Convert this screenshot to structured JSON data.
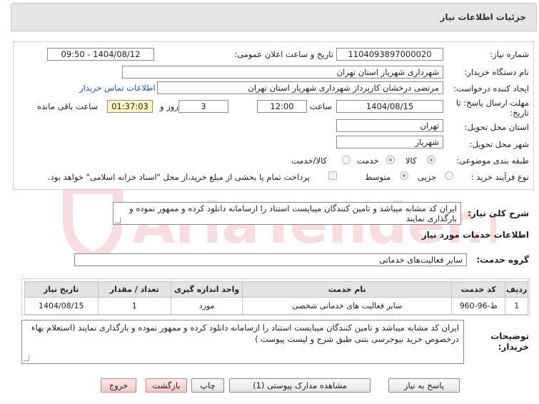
{
  "header": {
    "title": "جزئیات اطلاعات نیاز"
  },
  "form": {
    "need_number_label": "شماره نیاز:",
    "need_number": "1104093897000020",
    "announce_label": "تاریخ و ساعت اعلان عمومی:",
    "announce_value": "1404/08/12 - 09:50",
    "buyer_label": "نام دستگاه خریدار:",
    "buyer_value": "شهرداری شهریار استان تهران",
    "creator_label": "ایجاد کننده درخواست:",
    "creator_value": "مرتضی درخشان کارپرداز شهرداری شهریار استان تهران",
    "contact_link": "اطلاعات تماس خریدار",
    "deadline_label_1": "مهلت ارسال پاسخ: تا",
    "deadline_label_2": "تاریخ:",
    "deadline_date": "1404/08/15",
    "time_label": "ساعت",
    "deadline_time": "12:00",
    "days_value": "3",
    "days_label": "روز و",
    "remaining_time": "01:37:03",
    "remaining_label": "ساعت باقی مانده",
    "province_label": "استان محل تحویل:",
    "province_value": "تهران",
    "city_label": "شهر محل تحویل:",
    "city_value": "شهریار",
    "category_label": "طبقه بندی موضوعی:",
    "category_options": [
      "کالا",
      "خدمت",
      "کالا/خدمت"
    ],
    "process_label": "نوع فرآیند خرید :",
    "process_options": [
      "جزیی",
      "متوسط"
    ],
    "payment_note": "پرداخت تمام یا بخشی از مبلغ خرید،از محل \"اسناد خزانه اسلامی\" خواهد بود."
  },
  "summary": {
    "label": "شرح کلی نیاز:",
    "text": "ایران کد مشابه میباشد و تامین کنندگان میبایست استناد را ازسامانه دانلود کرده و ممهور نموده و بارگذاری نمایند"
  },
  "services": {
    "section_title": "اطلاعات خدمات مورد نیاز",
    "group_label": "گروه خدمت:",
    "group_value": "سایر فعالیت‌های خدماتی",
    "columns": [
      "ردیف",
      "کد خدمت",
      "نام خدمت",
      "واحد اندازه گیری",
      "تعداد / مقدار",
      "تاریخ نیاز"
    ],
    "rows": [
      [
        "1",
        "ط-96-960",
        "سایر فعالیت های خدماتی شخصی",
        "مورد",
        "1",
        "1404/08/15"
      ]
    ]
  },
  "notes": {
    "label_1": "توضیحات",
    "label_2": "خریدار:",
    "text": "ایران کد مشابه میباشد و تامین کنندگان میبایست استناد را ازسامانه دانلود کرده و ممهور نموده و بارگذاری نمایند (استعلام بهاء درخصوص خرید نیوجرسی بتنی طبق شرح و لیست پیوست )"
  },
  "buttons": {
    "reply": "پاسخ به نیاز",
    "attachments": "مشاهده مدارک پیوستی (1)",
    "print": "چاپ",
    "back": "بازگشت",
    "exit": "خروج"
  },
  "watermark": {
    "text": "AriaTender.net"
  }
}
